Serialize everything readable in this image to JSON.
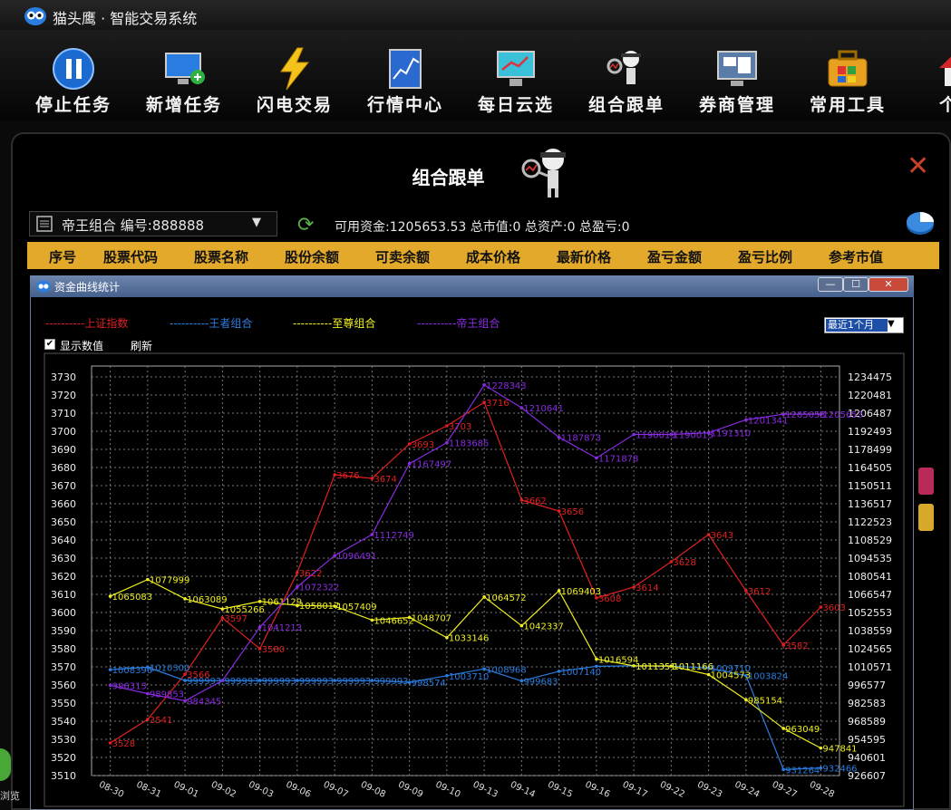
{
  "app": {
    "title": "猫头鹰 · 智能交易系统"
  },
  "toolbar": [
    {
      "label": "停止任务",
      "icon": "pause-icon"
    },
    {
      "label": "新增任务",
      "icon": "monitor-add-icon"
    },
    {
      "label": "闪电交易",
      "icon": "lightning-icon"
    },
    {
      "label": "行情中心",
      "icon": "market-chart-icon"
    },
    {
      "label": "每日云选",
      "icon": "trend-monitor-icon"
    },
    {
      "label": "组合跟单",
      "icon": "detective-icon"
    },
    {
      "label": "券商管理",
      "icon": "broker-monitor-icon"
    },
    {
      "label": "常用工具",
      "icon": "toolbox-icon"
    },
    {
      "label": "个人",
      "icon": "home-icon"
    }
  ],
  "panel": {
    "title": "组合跟单",
    "combo_text": "帝王组合 编号:888888",
    "summary": "可用资金:1205653.53 总市值:0 总资产:0 总盈亏:0",
    "columns": [
      "序号",
      "股票代码",
      "股票名称",
      "股份余额",
      "可卖余额",
      "成本价格",
      "最新价格",
      "盈亏金额",
      "盈亏比例",
      "参考市值"
    ]
  },
  "chart_window": {
    "title": "资金曲线统计",
    "range_value": "最近1个月",
    "show_values_label": "显示数值",
    "refresh_label": "刷新"
  },
  "bottom_left_text": "浏览",
  "colors": {
    "sh": "#e02020",
    "wangzhe": "#2a7de0",
    "zhizun": "#f0f020",
    "diwang": "#8a2be2",
    "header": "#e3a92a"
  },
  "chart_data": {
    "type": "line",
    "categories": [
      "08-30",
      "08-31",
      "09-01",
      "09-02",
      "09-03",
      "09-06",
      "09-07",
      "09-08",
      "09-09",
      "09-10",
      "09-13",
      "09-14",
      "09-15",
      "09-16",
      "09-17",
      "09-22",
      "09-23",
      "09-24",
      "09-27",
      "09-28"
    ],
    "left_axis": {
      "ylim": [
        3510,
        3730
      ],
      "ticks": [
        3510,
        3520,
        3530,
        3540,
        3550,
        3560,
        3570,
        3580,
        3590,
        3600,
        3610,
        3620,
        3630,
        3640,
        3650,
        3660,
        3670,
        3680,
        3690,
        3700,
        3710,
        3720,
        3730
      ]
    },
    "right_axis": {
      "ylim": [
        926607,
        1234475
      ],
      "ticks": [
        926607,
        940601,
        954595,
        968589,
        982583,
        996577,
        1010571,
        1024565,
        1038559,
        1052553,
        1066547,
        1080541,
        1094535,
        1108529,
        1122523,
        1136517,
        1150511,
        1164505,
        1178499,
        1192493,
        1206487,
        1220481,
        1234475
      ]
    },
    "series": [
      {
        "name": "上证指数",
        "axis": "left",
        "color": "#e02020",
        "style": "dashed-legend",
        "values": [
          3528,
          3541,
          3566,
          3597,
          3580,
          3622,
          3676,
          3674,
          3693,
          3703,
          3716,
          3662,
          3656,
          3608,
          3614,
          3628,
          3643,
          3612,
          3582,
          3603
        ]
      },
      {
        "name": "王者组合",
        "axis": "right",
        "color": "#2a7de0",
        "values": [
          1008396,
          1010300,
          999993,
          999993,
          999993,
          999993,
          999993,
          999993,
          998574,
          1003710,
          1008968,
          999683,
          1007140,
          1011000,
          1011351,
          1011166,
          1009710,
          1003824,
          931264,
          932466
        ],
        "labels": [
          "1008396",
          "1010300",
          "999993",
          "999993",
          "999993",
          "999993",
          "999993",
          "999993",
          "998574",
          "1003710",
          "1008968",
          "999683",
          "1007140",
          "",
          "1011351",
          "1011166",
          "1009710",
          "1003824",
          "931264",
          "932466"
        ]
      },
      {
        "name": "至尊组合",
        "axis": "right",
        "color": "#f0f020",
        "values": [
          1065083,
          1077999,
          1063089,
          1055266,
          1061129,
          1058017,
          1057409,
          1046652,
          1048707,
          1033146,
          1064572,
          1042337,
          1069403,
          1016594,
          1011351,
          1011166,
          1004573,
          985154,
          963049,
          947841
        ],
        "labels": [
          "1065083",
          "1077999",
          "1063089",
          "1055266",
          "1061129",
          "1058017",
          "1057409",
          "1046652",
          "1048707",
          "1033146",
          "1064572",
          "1042337",
          "1069403",
          "1016594",
          "1011351",
          "1011166",
          "1004573",
          "985154",
          "963049",
          "947841"
        ]
      },
      {
        "name": "帝王组合",
        "axis": "right",
        "color": "#8a2be2",
        "values": [
          996313,
          989853,
          984345,
          999993,
          1041213,
          1072322,
          1096491,
          1112749,
          1167497,
          1183685,
          1228343,
          1210641,
          1187873,
          1171878,
          1190013,
          1190013,
          1191310,
          1201341,
          1205653,
          1205653
        ],
        "labels": [
          "996313",
          "989853",
          "984345",
          "",
          "1041213",
          "1072322",
          "1096491",
          "1112749",
          "1167497",
          "1183685",
          "1228343",
          "1210641",
          "1187873",
          "1171878",
          "1190013",
          "1190013",
          "1191310",
          "1201341",
          "1205653",
          "1205653"
        ]
      }
    ],
    "grid": true,
    "legend_position": "top-left"
  }
}
